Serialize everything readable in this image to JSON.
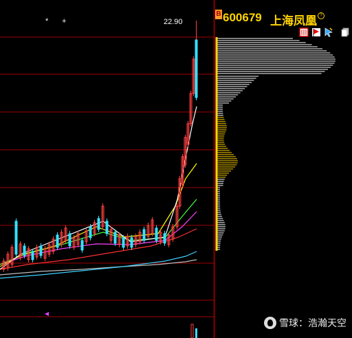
{
  "header": {
    "badge": "B",
    "stock_code": "600679",
    "stock_name": "上海凤凰",
    "info_icon": "info-circle-icon",
    "tools": [
      "bookmark-icon",
      "flag-icon",
      "cursor-icon",
      "copy-icon"
    ]
  },
  "chart": {
    "high_price_label": "22.90",
    "markers": [
      "*",
      "+"
    ],
    "colors": {
      "grid": "#a00000",
      "candle_up": "#ff4040",
      "candle_down": "#36e0ff",
      "ma5": "#ffffff",
      "ma10": "#ffff00",
      "ma20": "#ff40ff",
      "ma30": "#40ff40",
      "ma60": "#ff3030",
      "ma120": "#40d0ff",
      "ma250": "#c0c0c0",
      "volume_profile": "#ffffff",
      "volume_profile_accent": "#ffd400"
    }
  },
  "watermark": {
    "text": "雪球：浩瀚天空"
  }
}
